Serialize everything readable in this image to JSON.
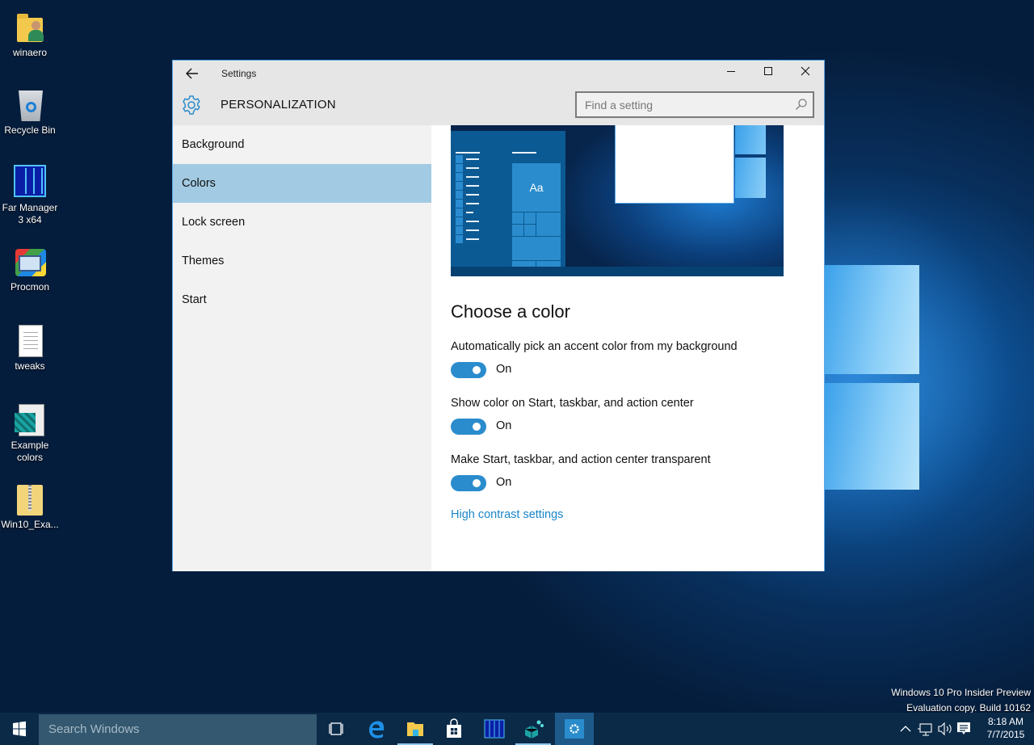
{
  "desktop": {
    "icons": [
      {
        "label": "winaero",
        "icon": "user-folder-icon"
      },
      {
        "label": "Recycle Bin",
        "icon": "recycle-bin-icon"
      },
      {
        "label": "Far Manager 3 x64",
        "line1": "Far Manager",
        "line2": "3 x64",
        "icon": "far-manager-icon"
      },
      {
        "label": "Procmon",
        "icon": "procmon-icon"
      },
      {
        "label": "tweaks",
        "icon": "text-document-icon"
      },
      {
        "label": "Example colors",
        "line1": "Example",
        "line2": "colors",
        "icon": "registry-file-icon"
      },
      {
        "label": "Win10_Exa...",
        "icon": "zip-folder-icon"
      }
    ],
    "watermark": {
      "line1": "Windows 10 Pro Insider Preview",
      "line2": "Evaluation copy. Build 10162"
    }
  },
  "window": {
    "title": "Settings",
    "back_icon": "back-arrow-icon",
    "controls": {
      "minimize": "—",
      "maximize": "☐",
      "close": "✕"
    },
    "section": "PERSONALIZATION",
    "search": {
      "placeholder": "Find a setting",
      "value": ""
    },
    "nav": [
      {
        "label": "Background",
        "selected": false
      },
      {
        "label": "Colors",
        "selected": true
      },
      {
        "label": "Lock screen",
        "selected": false
      },
      {
        "label": "Themes",
        "selected": false
      },
      {
        "label": "Start",
        "selected": false
      }
    ],
    "preview": {
      "tile_label": "Aa"
    },
    "content": {
      "heading": "Choose a color",
      "settings": [
        {
          "label": "Automatically pick an accent color from my background",
          "state": "On",
          "on": true
        },
        {
          "label": "Show color on Start, taskbar, and action center",
          "state": "On",
          "on": true
        },
        {
          "label": "Make Start, taskbar, and action center transparent",
          "state": "On",
          "on": true
        }
      ],
      "link": "High contrast settings"
    },
    "colors": {
      "accent": "#2a8ccd",
      "selected_nav": "#a2cbe3",
      "link": "#1a85c8"
    }
  },
  "taskbar": {
    "search_placeholder": "Search Windows",
    "apps": [
      {
        "name": "task-view",
        "icon": "task-view-icon"
      },
      {
        "name": "edge",
        "icon": "edge-icon"
      },
      {
        "name": "file-explorer",
        "icon": "file-explorer-icon",
        "running": true
      },
      {
        "name": "store",
        "icon": "store-icon"
      },
      {
        "name": "far-manager",
        "icon": "far-manager-icon"
      },
      {
        "name": "registry-editor",
        "icon": "registry-editor-icon",
        "running": true
      },
      {
        "name": "settings",
        "icon": "settings-gear-icon",
        "active": true
      }
    ],
    "tray": {
      "time": "8:18 AM",
      "date": "7/7/2015"
    }
  }
}
